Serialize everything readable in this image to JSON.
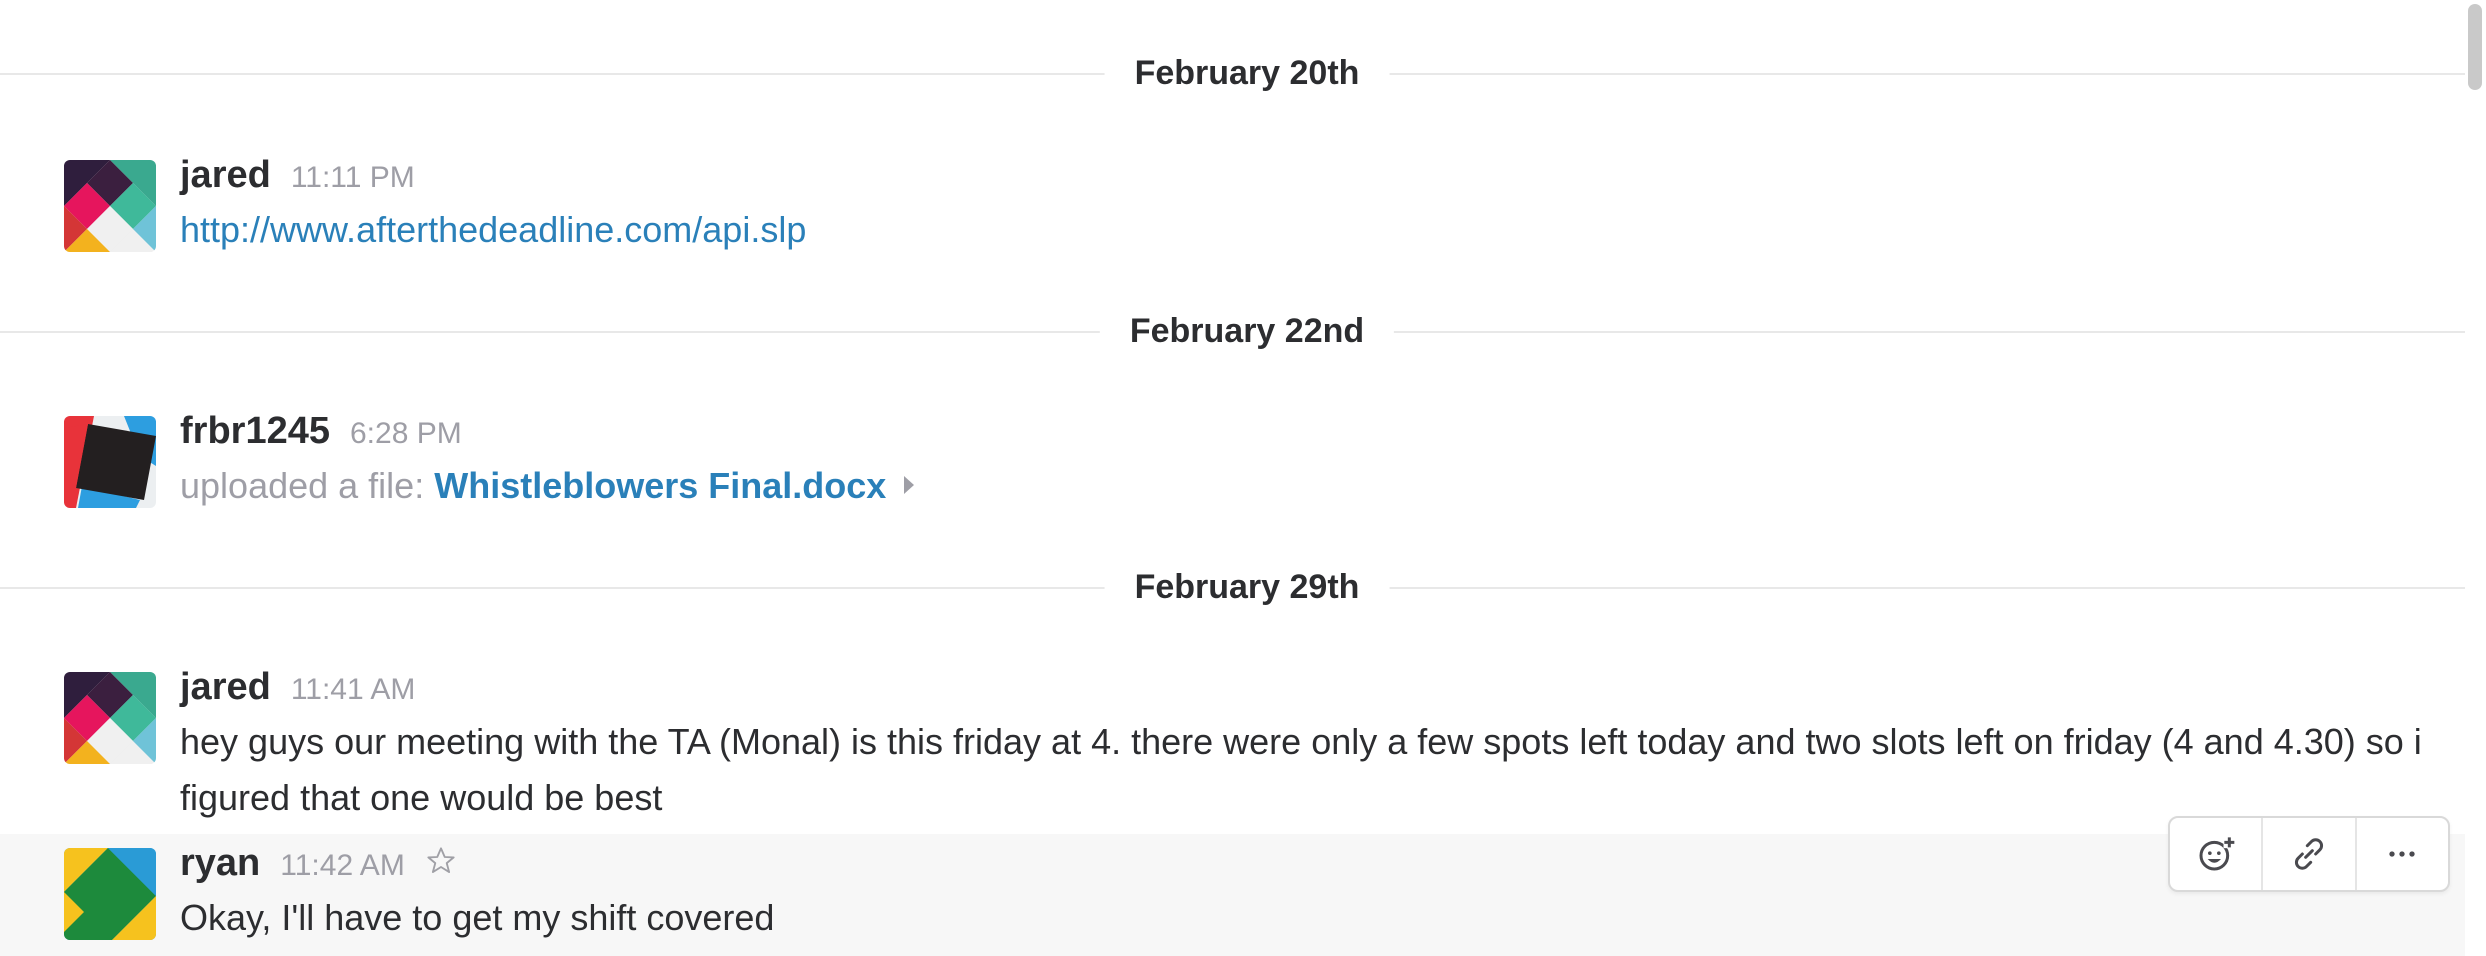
{
  "dividers": [
    {
      "label": "February 20th"
    },
    {
      "label": "February 22nd"
    },
    {
      "label": "February 29th"
    }
  ],
  "messages": [
    {
      "author": "jared",
      "time": "11:11 PM",
      "text": "http://www.afterthedeadline.com/api.slp"
    },
    {
      "author": "frbr1245",
      "time": "6:28 PM",
      "prefix": "uploaded a file:",
      "file_name": "Whistleblowers Final.docx"
    },
    {
      "author": "jared",
      "time": "11:41 AM",
      "text": "hey guys our meeting with the TA (Monal) is this friday at 4. there were only a few spots left today and two slots left on friday (4 and 4.30) so i figured that one would be best"
    },
    {
      "author": "ryan",
      "time": "11:42 AM",
      "text": "Okay, I'll have to get my shift covered"
    }
  ],
  "actions": [
    {
      "icon": "add-reaction-icon"
    },
    {
      "icon": "link-icon"
    },
    {
      "icon": "more-icon"
    }
  ],
  "colors": {
    "link": "#2a80b9",
    "muted": "#9e9ea6",
    "text": "#2c2d30",
    "hover_row": "#f7f7f7"
  }
}
